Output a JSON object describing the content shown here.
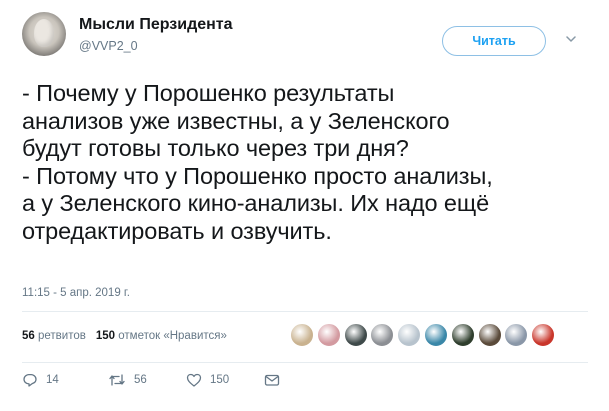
{
  "author": {
    "name": "Мысли Перзидента",
    "handle": "@VVP2_0"
  },
  "follow_label": "Читать",
  "tweet_lines": [
    "- Почему у Порошенко результаты",
    "анализов уже известны, а у Зеленского",
    "будут готовы только через три дня?",
    "- Потому что у Порошенко просто анализы,",
    "а у Зеленского кино-анализы. Их надо ещё",
    "отредактировать и озвучить."
  ],
  "timestamp": "11:15 - 5 апр. 2019 г.",
  "stats": {
    "retweets_count": "56",
    "retweets_label": "ретвитов",
    "likes_count": "150",
    "likes_label": "отметок «Нравится»"
  },
  "liker_colors": [
    "#c9b28f",
    "#d39aa0",
    "#3f4a4a",
    "#8c8f94",
    "#b7c3cd",
    "#3a87a8",
    "#2f3e2d",
    "#5a4a3a",
    "#8a97a8",
    "#c9362b"
  ],
  "actions": {
    "reply_count": "14",
    "retweet_count": "56",
    "like_count": "150"
  },
  "colors": {
    "accent": "#1da1f2",
    "secondary_text": "#657786"
  }
}
